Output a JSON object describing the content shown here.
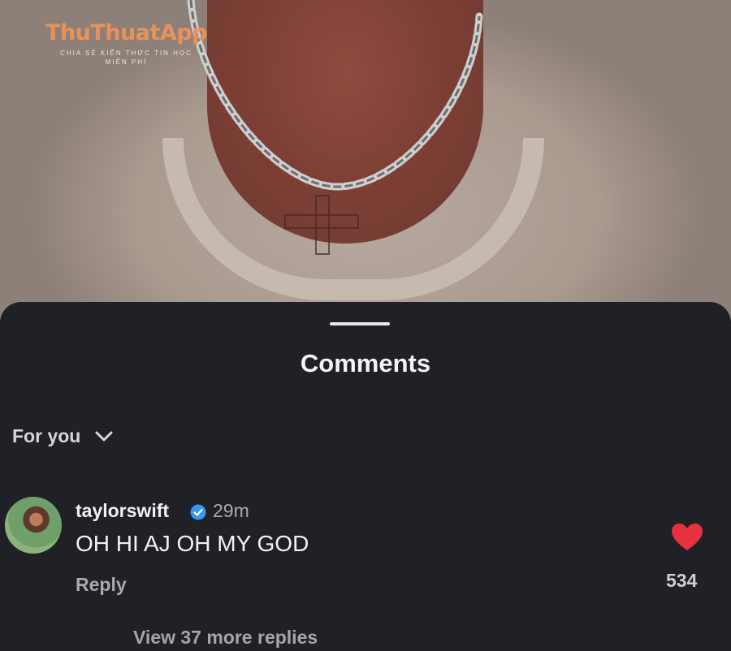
{
  "watermark": {
    "title": "ThuThuatApp",
    "subtitle_line1": "CHIA SẺ KIẾN THỨC TIN HỌC",
    "subtitle_line2": "MIỄN PHÍ"
  },
  "comments_sheet": {
    "title": "Comments",
    "filter_label": "For you",
    "comment": {
      "username": "taylorswift",
      "verified": true,
      "time_ago": "29m",
      "text": "OH HI AJ OH MY GOD",
      "reply_label": "Reply",
      "like_count": "534",
      "view_replies_label": "View 37 more replies"
    }
  },
  "colors": {
    "sheet_background": "#1f2126",
    "like_heart": "#e8313f",
    "verified_badge": "#3897f0",
    "watermark_brand": "#e8925a"
  },
  "icons": {
    "filter_dropdown": "chevron-down-icon",
    "verified": "verified-badge-icon",
    "like": "heart-icon"
  }
}
